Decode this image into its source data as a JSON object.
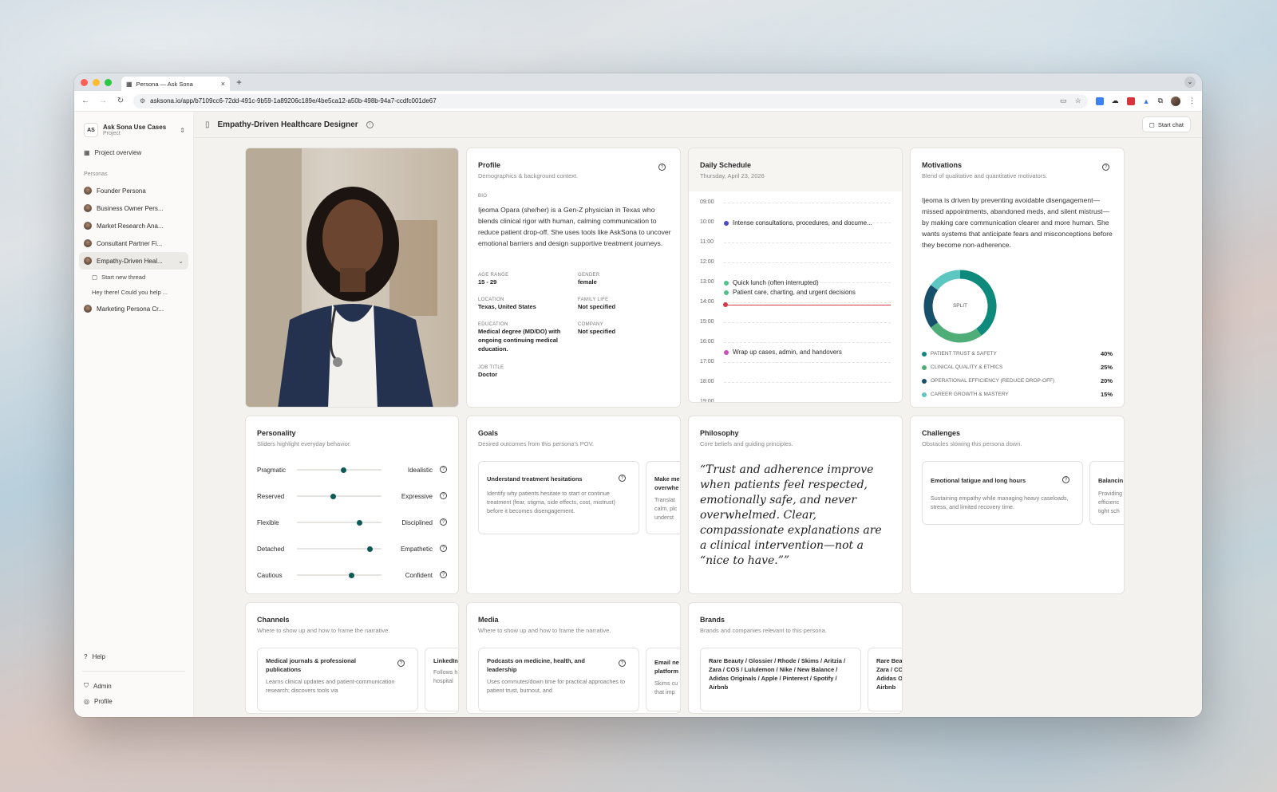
{
  "browser": {
    "tab_title": "Persona — Ask Sona",
    "url": "asksona.io/app/b7109cc6-72dd-491c-9b59-1a89206c189e/4be5ca12-a50b-498b-94a7-ccdfc001de67"
  },
  "sidebar": {
    "project_badge": "AS",
    "project_name": "Ask Sona Use Cases",
    "project_sub": "Project",
    "overview": "Project overview",
    "personas_label": "Personas",
    "personas": [
      {
        "label": "Founder Persona"
      },
      {
        "label": "Business Owner Pers..."
      },
      {
        "label": "Market Research Ana..."
      },
      {
        "label": "Consultant Partner Fi..."
      },
      {
        "label": "Empathy-Driven Heal..."
      },
      {
        "label": "Marketing Persona Cr..."
      }
    ],
    "start_thread": "Start new thread",
    "thread_preview": "Hey there! Could you help ...",
    "help": "Help",
    "admin": "Admin",
    "profile": "Profile"
  },
  "header": {
    "title": "Empathy-Driven Healthcare Designer",
    "start_chat": "Start chat"
  },
  "profile": {
    "title": "Profile",
    "subtitle": "Demographics & background context.",
    "bio_label": "BIO",
    "bio": "Ijeoma Opara (she/her) is a Gen-Z physician in Texas who blends clinical rigor with human, calming communication to reduce patient drop-off. She uses tools like AskSona to uncover emotional barriers and design supportive treatment journeys.",
    "age_label": "AGE RANGE",
    "age": "15 - 29",
    "gender_label": "GENDER",
    "gender": "female",
    "location_label": "LOCATION",
    "location": "Texas, United States",
    "family_label": "FAMILY LIFE",
    "family": "Not specified",
    "education_label": "EDUCATION",
    "education": "Medical degree (MD/DO) with ongoing continuing medical education.",
    "company_label": "COMPANY",
    "company": "Not specified",
    "job_label": "JOB TITLE",
    "job": "Doctor"
  },
  "schedule": {
    "title": "Daily Schedule",
    "date": "Thursday, April 23, 2026",
    "hours": [
      "09:00",
      "10:00",
      "11:00",
      "12:00",
      "13:00",
      "14:00",
      "15:00",
      "16:00",
      "17:00",
      "18:00",
      "19:00"
    ],
    "events": [
      {
        "label": "Intense consultations, procedures, and docume...",
        "color": "#4a4ad0"
      },
      {
        "label": "Quick lunch (often interrupted)",
        "color": "#4cc48a"
      },
      {
        "label": "Patient care, charting, and urgent decisions",
        "color": "#4cc48a"
      },
      {
        "label": "Wrap up cases, admin, and handovers",
        "color": "#d04ac0"
      }
    ]
  },
  "motivations": {
    "title": "Motivations",
    "subtitle": "Blend of qualitative and quantitative motivators.",
    "text": "Ijeoma is driven by preventing avoidable disengagement—missed appointments, abandoned meds, and silent mistrust—by making care communication clearer and more human. She wants systems that anticipate fears and misconceptions before they become non-adherence.",
    "donut_center": "SPLIT",
    "items": [
      {
        "label": "PATIENT TRUST & SAFETY",
        "pct": "40%",
        "value": 40,
        "color": "#0e8a7c"
      },
      {
        "label": "CLINICAL QUALITY & ETHICS",
        "pct": "25%",
        "value": 25,
        "color": "#4fae78"
      },
      {
        "label": "OPERATIONAL EFFICIENCY (REDUCE DROP-OFF)",
        "pct": "20%",
        "value": 20,
        "color": "#16506b"
      },
      {
        "label": "CAREER GROWTH & MASTERY",
        "pct": "15%",
        "value": 15,
        "color": "#5cc6c0"
      }
    ]
  },
  "personality": {
    "title": "Personality",
    "subtitle": "Sliders highlight everyday behavior.",
    "traits": [
      {
        "left": "Pragmatic",
        "right": "Idealistic",
        "value": 0.55
      },
      {
        "left": "Reserved",
        "right": "Expressive",
        "value": 0.42
      },
      {
        "left": "Flexible",
        "right": "Disciplined",
        "value": 0.74
      },
      {
        "left": "Detached",
        "right": "Empathetic",
        "value": 0.86
      },
      {
        "left": "Cautious",
        "right": "Confident",
        "value": 0.64
      }
    ]
  },
  "goals": {
    "title": "Goals",
    "subtitle": "Desired outcomes from this persona's POV.",
    "card1_title": "Understand treatment hesitations",
    "card1_desc": "Identify why patients hesitate to start or continue treatment (fear, stigma, side effects, cost, mistrust) before it becomes disengagement.",
    "card2_title": "Make me overwhe",
    "card2_desc": "Translat calm, plc underst"
  },
  "philosophy": {
    "title": "Philosophy",
    "subtitle": "Core beliefs and guiding principles.",
    "quote": "“Trust and adherence improve when patients feel respected, emotionally safe, and never overwhelmed. Clear, compassionate explanations are a clinical intervention—not a “nice to have.””"
  },
  "challenges": {
    "title": "Challenges",
    "subtitle": "Obstacles slowing this persona down.",
    "card1_title": "Emotional fatigue and long hours",
    "card1_desc": "Sustaining empathy while managing heavy caseloads, stress, and limited recovery time.",
    "card2_title": "Balancin",
    "card2_desc": "Providing efficienc tight sch"
  },
  "channels": {
    "title": "Channels",
    "subtitle": "Where to show up and how to frame the narrative.",
    "card1_title": "Medical journals & professional publications",
    "card1_desc": "Learns clinical updates and patient-communication research; discovers tools via",
    "card2_title": "LinkedIn",
    "card2_desc": "Follows h hospital"
  },
  "media": {
    "title": "Media",
    "subtitle": "Where to show up and how to frame the narrative.",
    "card1_title": "Podcasts on medicine, health, and leadership",
    "card1_desc": "Uses commutes/down time for practical approaches to patient trust, burnout, and",
    "card2_title": "Email ne platform",
    "card2_desc": "Skims cu that imp"
  },
  "brands": {
    "title": "Brands",
    "subtitle": "Brands and companies relevant to this persona.",
    "card1_title": "Rare Beauty / Glossier / Rhode / Skims / Aritzia / Zara / COS / Lululemon / Nike / New Balance / Adidas Originals / Apple / Pinterest / Spotify / Airbnb",
    "card2_title": "Rare Bea Zara / CO Adidas O Airbnb"
  }
}
